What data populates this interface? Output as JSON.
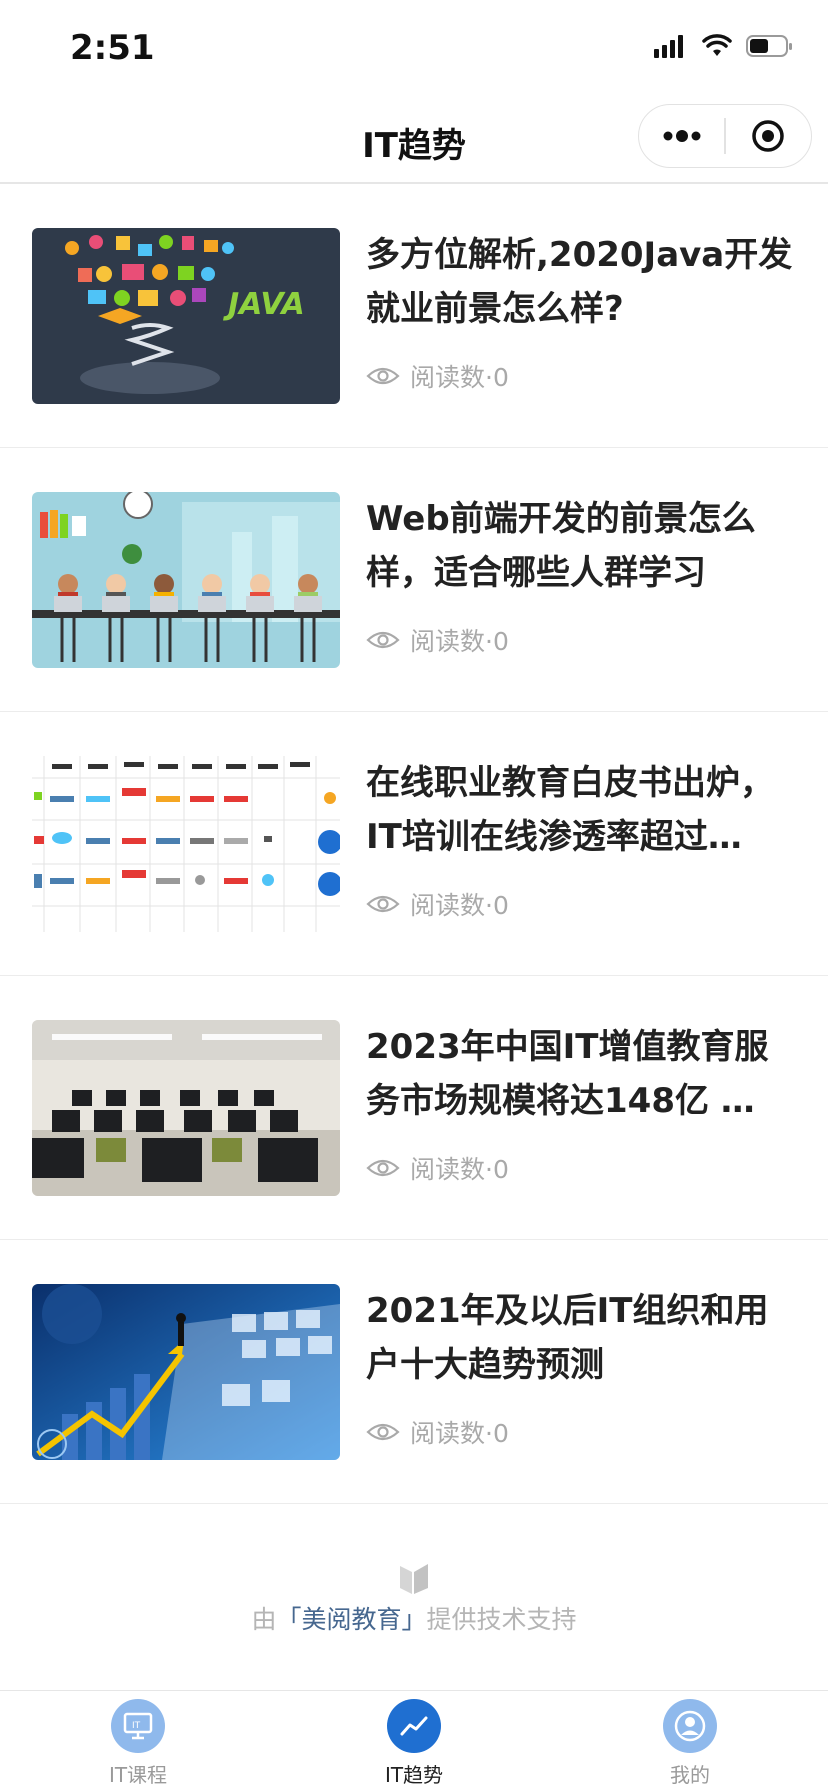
{
  "status_bar": {
    "time": "2:51"
  },
  "navbar": {
    "title": "IT趋势",
    "more_icon": "more-dots-icon",
    "close_icon": "target-icon"
  },
  "articles": [
    {
      "title": "多方位解析,2020Java开发就业前景怎么样?",
      "read_label": "阅读数·0",
      "image": "java-illustration"
    },
    {
      "title": "Web前端开发的前景怎么样，适合哪些人群学习",
      "read_label": "阅读数·0",
      "image": "people-with-laptops-illustration"
    },
    {
      "title": "在线职业教育白皮书出炉，IT培训在线渗透率超过…",
      "read_label": "阅读数·0",
      "image": "education-brands-table"
    },
    {
      "title": "2023年中国IT增值教育服务市场规模将达148亿 …",
      "read_label": "阅读数·0",
      "image": "computer-classroom-photo"
    },
    {
      "title": "2021年及以后IT组织和用户十大趋势预测",
      "read_label": "阅读数·0",
      "image": "business-growth-blue-collage"
    }
  ],
  "credit": {
    "prefix": "由",
    "brand": "「美阅教育」",
    "suffix": "提供技术支持"
  },
  "tabbar": {
    "tabs": [
      {
        "label": "IT课程",
        "icon": "monitor-icon"
      },
      {
        "label": "IT趋势",
        "icon": "trend-chart-icon",
        "active": true
      },
      {
        "label": "我的",
        "icon": "user-icon"
      }
    ]
  },
  "colors": {
    "accent": "#1f6fd1",
    "tab_inactive": "#7fb0e8",
    "meta_gray": "#a9a9a9",
    "brand_text": "#46678f"
  }
}
